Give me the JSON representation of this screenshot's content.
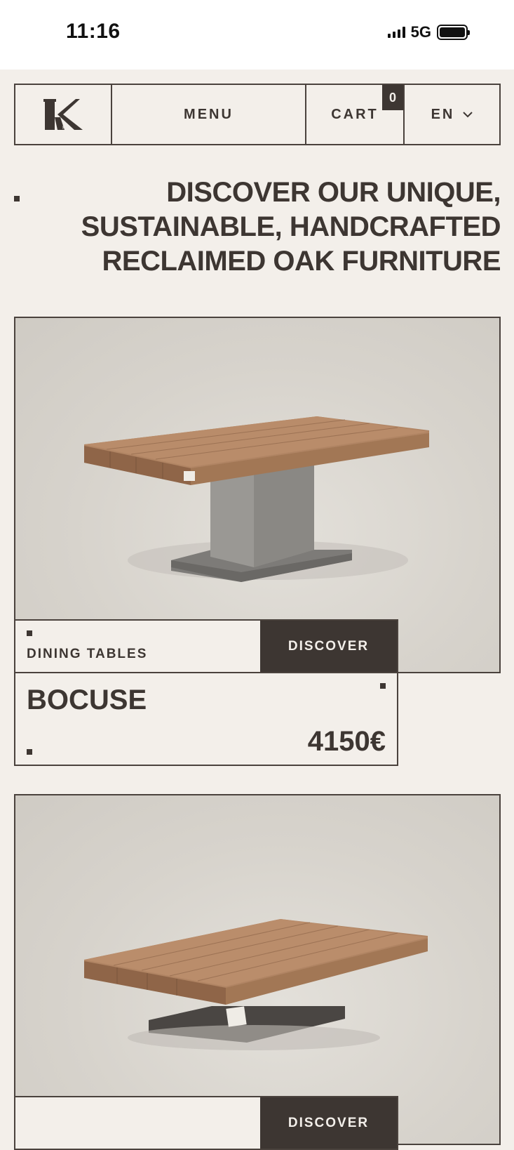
{
  "status_bar": {
    "time": "11:16",
    "network": "5G"
  },
  "nav": {
    "logo_letter": "K",
    "menu_label": "MENU",
    "cart_label": "CART",
    "cart_count": "0",
    "lang_label": "EN"
  },
  "hero": {
    "title_lines": [
      "DISCOVER OUR UNIQUE,",
      "SUSTAINABLE, HANDCRAFTED",
      "RECLAIMED OAK FURNITURE"
    ]
  },
  "products": [
    {
      "category": "DINING TABLES",
      "cta": "DISCOVER",
      "name": "BOCUSE",
      "price": "4150€"
    },
    {
      "cta": "DISCOVER"
    }
  ],
  "colors": {
    "background": "#f3efea",
    "ink": "#3d3632",
    "wood": "#a77a5c",
    "concrete": "#8f8c88"
  }
}
